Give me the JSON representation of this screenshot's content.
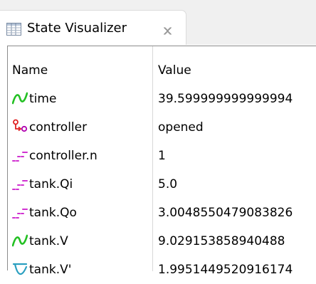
{
  "tab": {
    "title": "State Visualizer",
    "icon": "table-view-icon",
    "close_icon": "close-icon"
  },
  "columns": {
    "name": "Name",
    "value": "Value"
  },
  "rows": [
    {
      "name": "time",
      "value": "39.599999999999994",
      "icon": "continuous-variable-icon"
    },
    {
      "name": "controller",
      "value": "opened",
      "icon": "state-machine-icon"
    },
    {
      "name": "controller.n",
      "value": "1",
      "icon": "discrete-variable-icon"
    },
    {
      "name": "tank.Qi",
      "value": "5.0",
      "icon": "discrete-variable-icon"
    },
    {
      "name": "tank.Qo",
      "value": "3.0048550479083826",
      "icon": "discrete-variable-icon"
    },
    {
      "name": "tank.V",
      "value": "9.029153858940488",
      "icon": "continuous-variable-icon"
    },
    {
      "name": "tank.V'",
      "value": "1.9951449520916174",
      "icon": "derivative-variable-icon"
    }
  ],
  "colors": {
    "continuous": "#22c022",
    "state": "#e02020",
    "state_dot": "#b000b0",
    "discrete": "#d030d0",
    "derivative": "#2a9fc0"
  }
}
